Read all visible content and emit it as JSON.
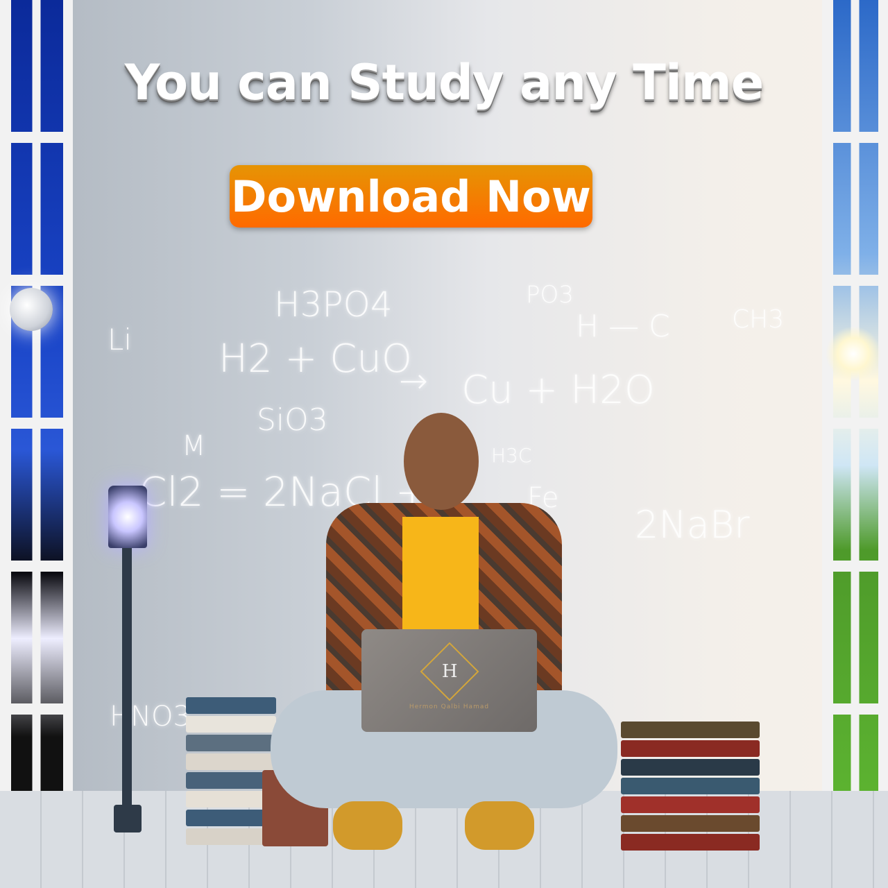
{
  "headline": "You can Study any Time",
  "cta_button": {
    "label": "Download Now",
    "color_top": "#e69404",
    "color_bottom": "#ff6a00"
  },
  "formulas": [
    "H3PO4",
    "Li",
    "H2 + CuO",
    "→",
    "Cu + H2O",
    "SiO3",
    "M",
    "Cl2 = 2NaCl +",
    "PO3",
    "H — C",
    "CH3",
    "H3C",
    "Fe",
    "2NaBr",
    "HNO3"
  ],
  "laptop": {
    "logo_letter": "H",
    "brand_text": "Hermon Qalbi Hamad"
  }
}
